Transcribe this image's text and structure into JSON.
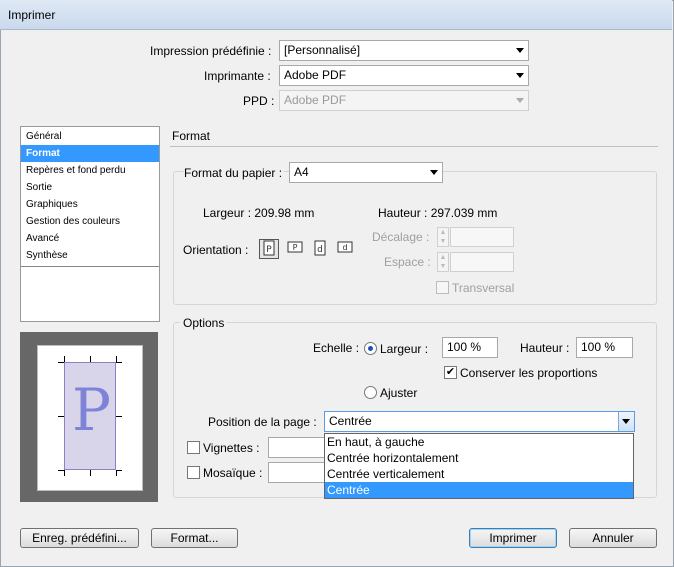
{
  "window": {
    "title": "Imprimer"
  },
  "top": {
    "preset_label": "Impression prédéfinie :",
    "preset_value": "[Personnalisé]",
    "printer_label": "Imprimante :",
    "printer_value": "Adobe PDF",
    "ppd_label": "PPD :",
    "ppd_value": "Adobe PDF"
  },
  "sidebar": {
    "items": [
      {
        "label": "Général",
        "selected": false
      },
      {
        "label": "Format",
        "selected": true
      },
      {
        "label": "Repères et fond perdu",
        "selected": false
      },
      {
        "label": "Sortie",
        "selected": false
      },
      {
        "label": "Graphiques",
        "selected": false
      },
      {
        "label": "Gestion des couleurs",
        "selected": false
      },
      {
        "label": "Avancé",
        "selected": false
      },
      {
        "label": "Synthèse",
        "selected": false
      }
    ]
  },
  "preview": {
    "letter": "P"
  },
  "format_section": {
    "title": "Format",
    "paper_label": "Format du papier :",
    "paper_value": "A4",
    "width_text": "Largeur : 209.98 mm",
    "height_text": "Hauteur : 297.039 mm",
    "orientation_label": "Orientation :",
    "orientation_icons": [
      "portrait-icon",
      "landscape-icon",
      "reverse-portrait-icon",
      "reverse-landscape-icon"
    ],
    "offset_label": "Décalage :",
    "gap_label": "Espace :",
    "transverse_label": "Transversal"
  },
  "options_section": {
    "title": "Options",
    "scale_label": "Echelle :",
    "width_label": "Largeur :",
    "width_value": "100 %",
    "height_label": "Hauteur :",
    "height_value": "100 %",
    "keep_proportions_label": "Conserver les proportions",
    "keep_proportions_checked": true,
    "fit_label": "Ajuster",
    "page_position_label": "Position de la page :",
    "page_position_value": "Centrée",
    "page_position_options": [
      "En haut, à gauche",
      "Centrée horizontalement",
      "Centrée verticalement",
      "Centrée"
    ],
    "page_position_selected": "Centrée",
    "thumbnails_label": "Vignettes :",
    "tile_label": "Mosaïque :"
  },
  "buttons": {
    "save_preset": "Enreg. prédéfini...",
    "setup": "Format...",
    "print": "Imprimer",
    "cancel": "Annuler"
  },
  "colors": {
    "selection": "#3399ff",
    "titlebar": "#c9d9ec"
  }
}
